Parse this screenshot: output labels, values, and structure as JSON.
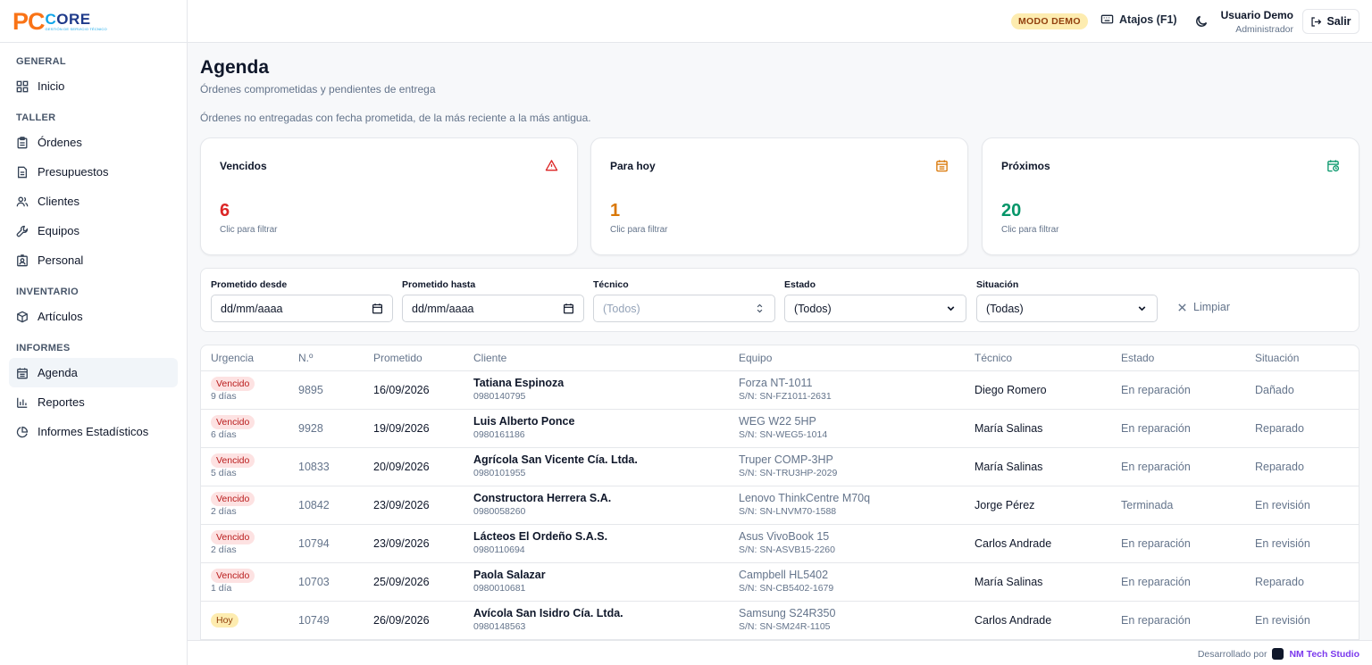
{
  "logo": {
    "pc": "PC",
    "core_c": "C",
    "core_rest": "ORE",
    "tagline": "GESTIÓN DE SERVICIO TÉCNICO"
  },
  "sidebar": {
    "sections": [
      {
        "title": "GENERAL",
        "items": [
          {
            "label": "Inicio",
            "icon": "grid-icon"
          }
        ]
      },
      {
        "title": "TALLER",
        "items": [
          {
            "label": "Órdenes",
            "icon": "clipboard-icon"
          },
          {
            "label": "Presupuestos",
            "icon": "file-text-icon"
          },
          {
            "label": "Clientes",
            "icon": "users-icon"
          },
          {
            "label": "Equipos",
            "icon": "wrench-icon"
          },
          {
            "label": "Personal",
            "icon": "id-badge-icon"
          }
        ]
      },
      {
        "title": "INVENTARIO",
        "items": [
          {
            "label": "Artículos",
            "icon": "package-icon"
          }
        ]
      },
      {
        "title": "INFORMES",
        "items": [
          {
            "label": "Agenda",
            "icon": "calendar-icon",
            "active": true
          },
          {
            "label": "Reportes",
            "icon": "bar-chart-icon"
          },
          {
            "label": "Informes Estadísticos",
            "icon": "pie-chart-icon"
          }
        ]
      }
    ]
  },
  "topbar": {
    "demo_badge": "MODO DEMO",
    "shortcuts": "Atajos (F1)",
    "user_name": "Usuario Demo",
    "user_role": "Administrador",
    "logout": "Salir"
  },
  "page": {
    "title": "Agenda",
    "subtitle": "Órdenes comprometidas y pendientes de entrega",
    "description": "Órdenes no entregadas con fecha prometida, de la más reciente a la más antigua."
  },
  "cards": [
    {
      "title": "Vencidos",
      "value": "6",
      "hint": "Clic para filtrar",
      "color": "#dc2626",
      "icon": "alert-triangle-icon"
    },
    {
      "title": "Para hoy",
      "value": "1",
      "hint": "Clic para filtrar",
      "color": "#d97706",
      "icon": "calendar-icon"
    },
    {
      "title": "Próximos",
      "value": "20",
      "hint": "Clic para filtrar",
      "color": "#059669",
      "icon": "calendar-clock-icon"
    }
  ],
  "filters": {
    "from_label": "Prometido desde",
    "from_value": "dd/mm/aaaa",
    "to_label": "Prometido hasta",
    "to_value": "dd/mm/aaaa",
    "tech_label": "Técnico",
    "tech_value": "(Todos)",
    "status_label": "Estado",
    "status_value": "(Todos)",
    "situation_label": "Situación",
    "situation_value": "(Todas)",
    "clear": "Limpiar"
  },
  "table": {
    "headers": [
      "Urgencia",
      "N.º",
      "Prometido",
      "Cliente",
      "Equipo",
      "Técnico",
      "Estado",
      "Situación"
    ],
    "rows": [
      {
        "badge": "Vencido",
        "badge_type": "red",
        "days": "9 días",
        "num": "9895",
        "date": "16/09/2026",
        "client": "Tatiana Espinoza",
        "phone": "0980140795",
        "equip": "Forza NT-1011",
        "serial": "S/N: SN-FZ1011-2631",
        "tech": "Diego Romero",
        "status": "En reparación",
        "situation": "Dañado"
      },
      {
        "badge": "Vencido",
        "badge_type": "red",
        "days": "6 días",
        "num": "9928",
        "date": "19/09/2026",
        "client": "Luis Alberto Ponce",
        "phone": "0980161186",
        "equip": "WEG W22 5HP",
        "serial": "S/N: SN-WEG5-1014",
        "tech": "María Salinas",
        "status": "En reparación",
        "situation": "Reparado"
      },
      {
        "badge": "Vencido",
        "badge_type": "red",
        "days": "5 días",
        "num": "10833",
        "date": "20/09/2026",
        "client": "Agrícola San Vicente Cía. Ltda.",
        "phone": "0980101955",
        "equip": "Truper COMP-3HP",
        "serial": "S/N: SN-TRU3HP-2029",
        "tech": "María Salinas",
        "status": "En reparación",
        "situation": "Reparado"
      },
      {
        "badge": "Vencido",
        "badge_type": "red",
        "days": "2 días",
        "num": "10842",
        "date": "23/09/2026",
        "client": "Constructora Herrera S.A.",
        "phone": "0980058260",
        "equip": "Lenovo ThinkCentre M70q",
        "serial": "S/N: SN-LNVM70-1588",
        "tech": "Jorge Pérez",
        "status": "Terminada",
        "situation": "En revisión"
      },
      {
        "badge": "Vencido",
        "badge_type": "red",
        "days": "2 días",
        "num": "10794",
        "date": "23/09/2026",
        "client": "Lácteos El Ordeño S.A.S.",
        "phone": "0980110694",
        "equip": "Asus VivoBook 15",
        "serial": "S/N: SN-ASVB15-2260",
        "tech": "Carlos Andrade",
        "status": "En reparación",
        "situation": "En revisión"
      },
      {
        "badge": "Vencido",
        "badge_type": "red",
        "days": "1 día",
        "num": "10703",
        "date": "25/09/2026",
        "client": "Paola Salazar",
        "phone": "0980010681",
        "equip": "Campbell HL5402",
        "serial": "S/N: SN-CB5402-1679",
        "tech": "María Salinas",
        "status": "En reparación",
        "situation": "Reparado"
      },
      {
        "badge": "Hoy",
        "badge_type": "amber",
        "days": "",
        "num": "10749",
        "date": "26/09/2026",
        "client": "Avícola San Isidro Cía. Ltda.",
        "phone": "0980148563",
        "equip": "Samsung S24R350",
        "serial": "S/N: SN-SM24R-1105",
        "tech": "Carlos Andrade",
        "status": "En reparación",
        "situation": "En revisión"
      }
    ]
  },
  "footer": {
    "prefix": "Desarrollado por",
    "brand": "NM Tech Studio"
  }
}
